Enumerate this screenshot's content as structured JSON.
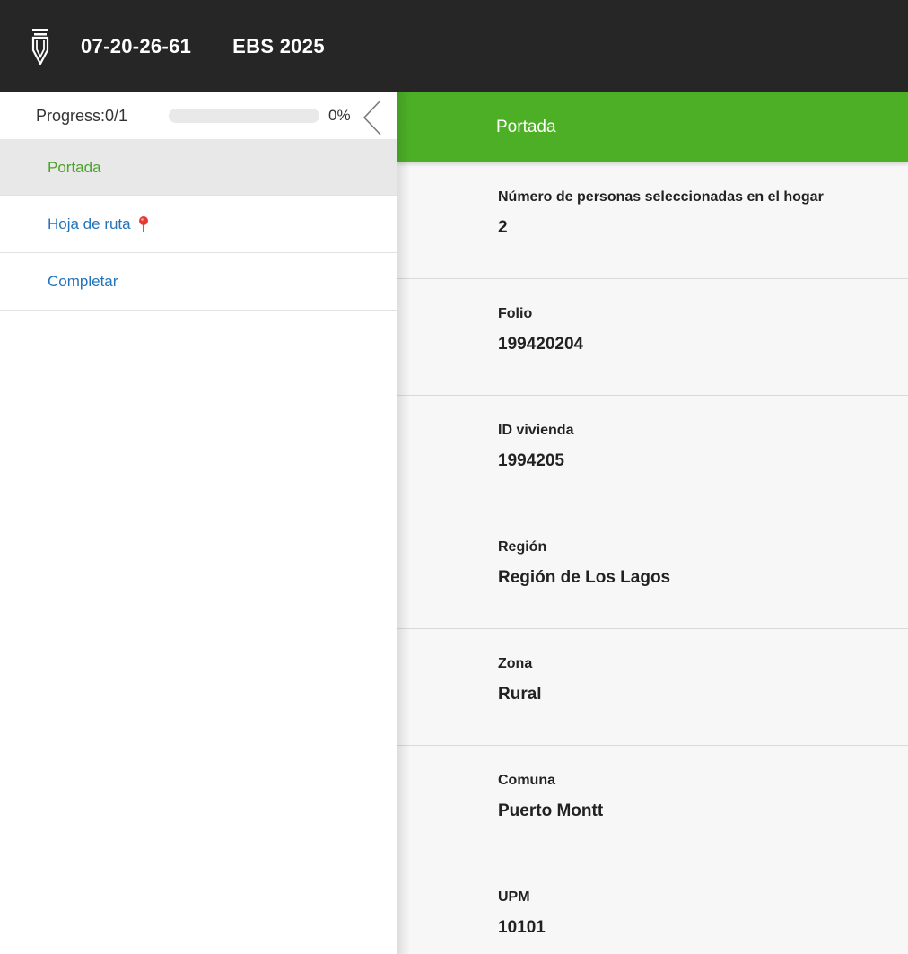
{
  "header": {
    "case_id": "07-20-26-61",
    "survey_name": "EBS 2025",
    "logo_icon": "pen-nib-icon"
  },
  "sidebar": {
    "progress": {
      "label": "Progress:0/1",
      "percent_text": "0%",
      "fraction": 0
    },
    "collapse_icon": "chevron-left-icon",
    "items": [
      {
        "label": "Portada",
        "active": true
      },
      {
        "label": "Hoja de ruta",
        "icon": "map-pin-icon"
      },
      {
        "label": "Completar"
      }
    ]
  },
  "main": {
    "section_title": "Portada",
    "fields": [
      {
        "label": "Número de personas seleccionadas en el hogar",
        "value": "2"
      },
      {
        "label": "Folio",
        "value": "199420204"
      },
      {
        "label": "ID vivienda",
        "value": "1994205"
      },
      {
        "label": "Región",
        "value": "Región de Los Lagos"
      },
      {
        "label": "Zona",
        "value": "Rural"
      },
      {
        "label": "Comuna",
        "value": "Puerto Montt"
      },
      {
        "label": "UPM",
        "value": "10101"
      }
    ]
  },
  "colors": {
    "topbar": "#262626",
    "accent_green": "#4caf26",
    "link_blue": "#2474bc",
    "active_text_green": "#4ca22a",
    "pin_red": "#e53935"
  }
}
